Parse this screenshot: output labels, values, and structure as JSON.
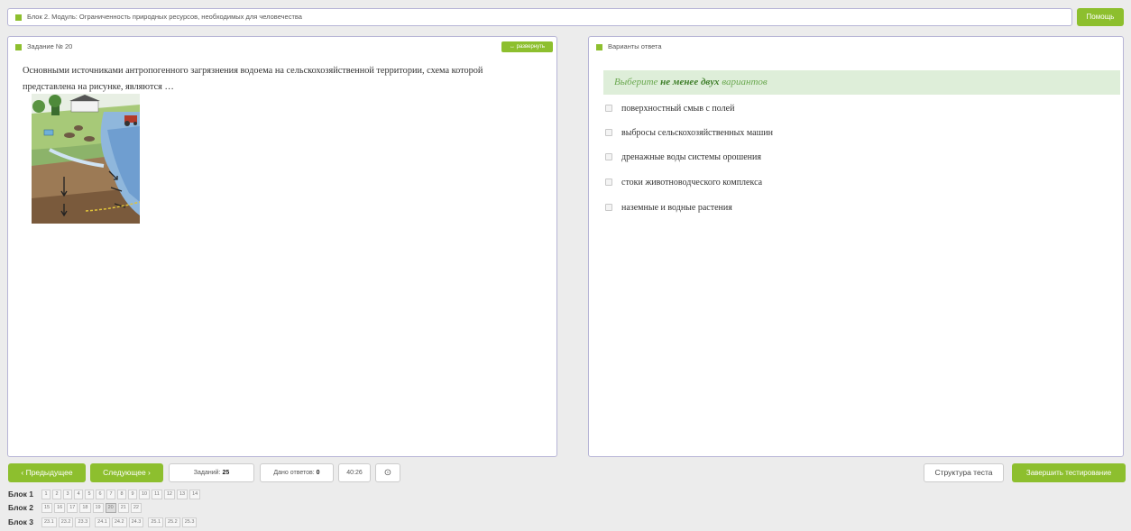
{
  "header": {
    "module": "Блок 2. Модуль: Ограниченность природных ресурсов, необходимых для человечества",
    "help_label": "Помощь"
  },
  "task": {
    "title": "Задание № 20",
    "expand_label": "развернуть",
    "question": "Основными источниками антропогенного загрязнения водоема на сельскохозяйственной территории, схема которой представлена на рисунке, являются …"
  },
  "answers_panel": {
    "title": "Варианты ответа",
    "instruction_prefix": "Выберите ",
    "instruction_bold": "не менее двух",
    "instruction_suffix": " вариантов",
    "options": [
      "поверхностный смыв с полей",
      "выбросы сельскохозяйственных машин",
      "дренажные воды системы орошения",
      "стоки животноводческого комплекса",
      "наземные и водные растения"
    ]
  },
  "footer": {
    "prev_label": "Предыдущее",
    "next_label": "Следующее",
    "tasks_label": "Заданий:",
    "tasks_value": "25",
    "answered_label": "Дано ответов:",
    "answered_value": "0",
    "timer": "40:26",
    "structure_label": "Структура теста",
    "finish_label": "Завершить тестирование"
  },
  "blocks": [
    {
      "label": "Блок 1",
      "groups": [
        [
          "1",
          "2",
          "3",
          "4",
          "5",
          "6",
          "7",
          "8",
          "9",
          "10",
          "11",
          "12",
          "13",
          "14"
        ]
      ]
    },
    {
      "label": "Блок 2",
      "groups": [
        [
          "15",
          "16",
          "17",
          "18",
          "19",
          "20",
          "21",
          "22"
        ]
      ]
    },
    {
      "label": "Блок 3",
      "groups": [
        [
          "23.1",
          "23.2",
          "23.3"
        ],
        [
          "24.1",
          "24.2",
          "24.3"
        ],
        [
          "25.1",
          "25.2",
          "25.3"
        ]
      ]
    }
  ],
  "current_task": "20",
  "colors": {
    "accent": "#8dbf2e",
    "panel_border": "#b7b5d6",
    "instruction_bg": "#deeed9"
  },
  "icons": {
    "prev": "chevron-left-icon",
    "next": "chevron-right-icon",
    "timer": "stopwatch-icon"
  }
}
